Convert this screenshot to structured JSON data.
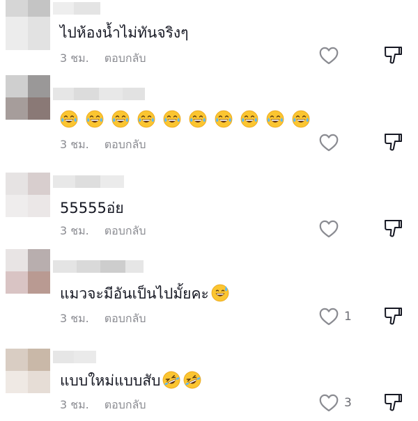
{
  "comments": [
    {
      "text": "ไปห้องน้ำไม่ทันจริงๆ",
      "time": "3 ชม.",
      "reply": "ตอบกลับ",
      "likes": "",
      "avatar_colors": [
        "#d6d6d6",
        "#c4c4c4",
        "#ececec",
        "#e2e2e2"
      ]
    },
    {
      "text": "",
      "emojis": [
        "joy-emoji",
        "joy-emoji",
        "joy-emoji",
        "joy-emoji",
        "joy-emoji",
        "joy-emoji",
        "joy-emoji",
        "joy-emoji",
        "joy-emoji",
        "joy-emoji"
      ],
      "time": "3 ชม.",
      "reply": "ตอบกลับ",
      "likes": "",
      "avatar_colors": [
        "#cfcfcf",
        "#9a9898",
        "#a69d9b",
        "#8a7976"
      ]
    },
    {
      "text": "55555อ่ย",
      "time": "3 ชม.",
      "reply": "ตอบกลับ",
      "likes": "",
      "avatar_colors": [
        "#e6e3e3",
        "#d8cece",
        "#efeded",
        "#ebe7e7"
      ]
    },
    {
      "text": "แมวจะมีอันเป็นไปมั้ยคะ",
      "emoji_after": "sweat-smile-emoji",
      "time": "3 ชม.",
      "reply": "ตอบกลับ",
      "likes": "1",
      "avatar_colors": [
        "#e8e4e4",
        "#b8aeae",
        "#d9c4c4",
        "#b99a92"
      ]
    },
    {
      "text": "แบบใหม่แบบสับ",
      "emoji_after": "rofl-emoji x2",
      "time": "3 ชม.",
      "reply": "ตอบกลับ",
      "likes": "3",
      "avatar_colors": [
        "#d9cdc3",
        "#c9b8a8",
        "#efe9e4",
        "#e6ddd6"
      ]
    }
  ],
  "icons": {
    "like": "heart-outline-icon",
    "dislike": "thumbs-down-icon"
  },
  "colors": {
    "text": "#161823",
    "muted": "#8a8b91"
  }
}
